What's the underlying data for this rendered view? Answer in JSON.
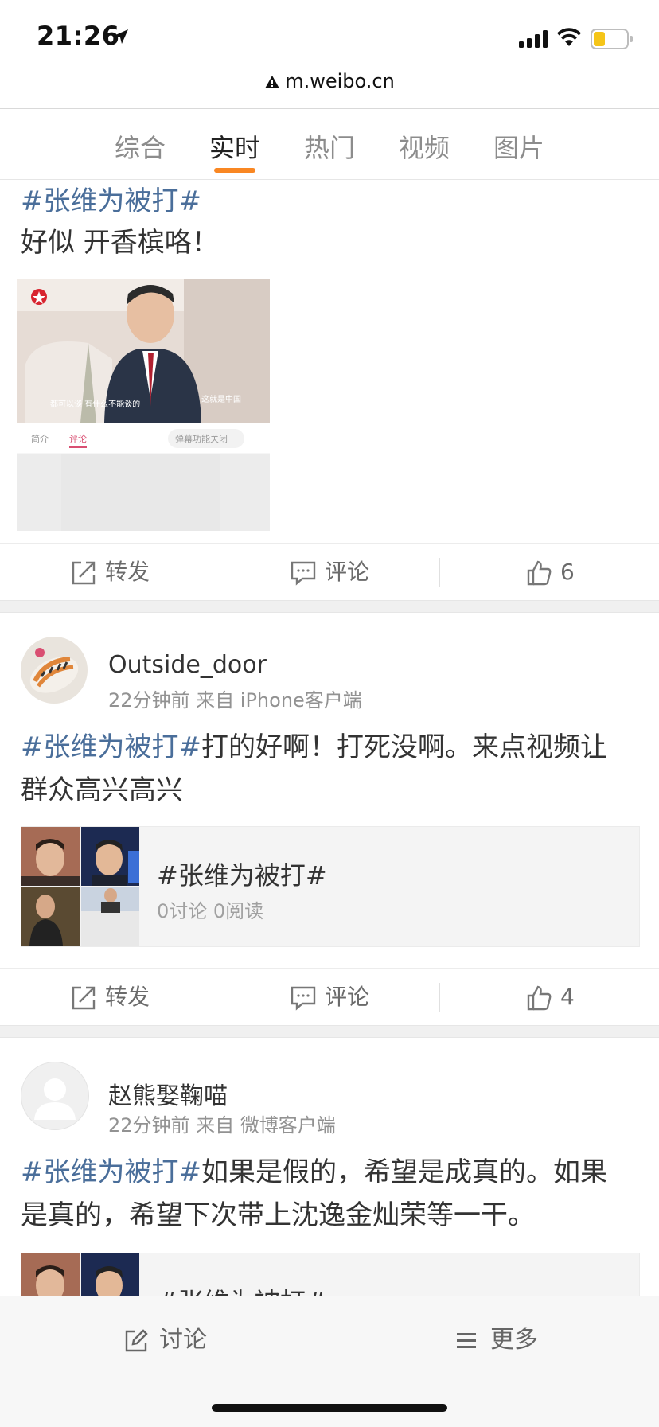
{
  "status_bar": {
    "time": "21:26"
  },
  "url_bar": {
    "domain": "m.weibo.cn"
  },
  "tabs": [
    {
      "label": "综合"
    },
    {
      "label": "实时"
    },
    {
      "label": "热门"
    },
    {
      "label": "视频"
    },
    {
      "label": "图片"
    }
  ],
  "active_tab": "实时",
  "colors": {
    "accent": "#f98723",
    "topic_link": "#4a6e9a"
  },
  "post1": {
    "topic": "#张维为被打#",
    "text": "好似 开香槟咯！",
    "video": {
      "caption": "都可以谈 有什么不能谈的",
      "watermark": "这就是中国",
      "tab_intro": "简介",
      "tab_comments": "评论",
      "danmaku_toggle": "弹幕功能关闭"
    },
    "actions": {
      "repost": "转发",
      "comment": "评论",
      "like_count": "6"
    }
  },
  "post2": {
    "username": "Outside_door",
    "meta": "22分钟前 来自 iPhone客户端",
    "topic": "#张维为被打#",
    "text": "打的好啊！打死没啊。来点视频让群众高兴高兴",
    "topic_card": {
      "title": "#张维为被打#",
      "stats": "0讨论 0阅读"
    },
    "actions": {
      "repost": "转发",
      "comment": "评论",
      "like_count": "4"
    }
  },
  "post3": {
    "username": "赵熊娶鞠喵",
    "meta": "22分钟前 来自 微博客户端",
    "topic": "#张维为被打#",
    "text": "如果是假的，希望是成真的。如果是真的，希望下次带上沈逸金灿荣等一干。",
    "topic_card": {
      "title": "#张维为被打#"
    }
  },
  "bottom_bar": {
    "discuss": "讨论",
    "more": "更多"
  }
}
